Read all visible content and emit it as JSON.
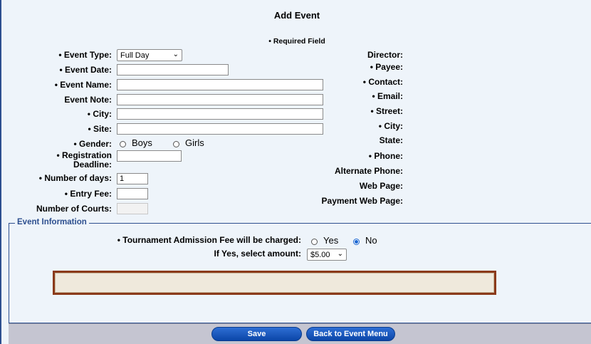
{
  "title": "Add Event",
  "required_note": "• Required Field",
  "left_form": {
    "event_type_label": "• Event Type:",
    "event_type_value": "Full Day",
    "event_date_label": "• Event Date:",
    "event_name_label": "• Event Name:",
    "event_note_label": "Event Note:",
    "city_label": "• City:",
    "site_label": "• Site:",
    "gender_label": "• Gender:",
    "gender_options": [
      "Boys",
      "Girls"
    ],
    "reg_deadline_label_1": "• Registration",
    "reg_deadline_label_2": "Deadline:",
    "num_days_label": "• Number of days:",
    "num_days_value": "1",
    "entry_fee_label": "• Entry Fee:",
    "num_courts_label": "Number of Courts:"
  },
  "right_info": {
    "director": "Director:",
    "payee": "• Payee:",
    "contact": "• Contact:",
    "email": "• Email:",
    "street": "• Street:",
    "city": "• City:",
    "state": "State:",
    "phone": "• Phone:",
    "alt_phone": "Alternate Phone:",
    "web_page": "Web Page:",
    "payment_web_page": "Payment Web Page:"
  },
  "event_info": {
    "legend": "Event Information",
    "admission_label": "• Tournament Admission Fee will be charged:",
    "admission_options": [
      "Yes",
      "No"
    ],
    "admission_selected": "No",
    "amount_label": "If Yes, select amount:",
    "amount_value": "$5.00"
  },
  "footer": {
    "save": "Save",
    "back": "Back to Event Menu"
  },
  "colors": {
    "accent": "#2d4f8f",
    "button": "#1a56bf",
    "message_border": "#8b3a1a",
    "footer_bg": "#c5c5d1"
  }
}
